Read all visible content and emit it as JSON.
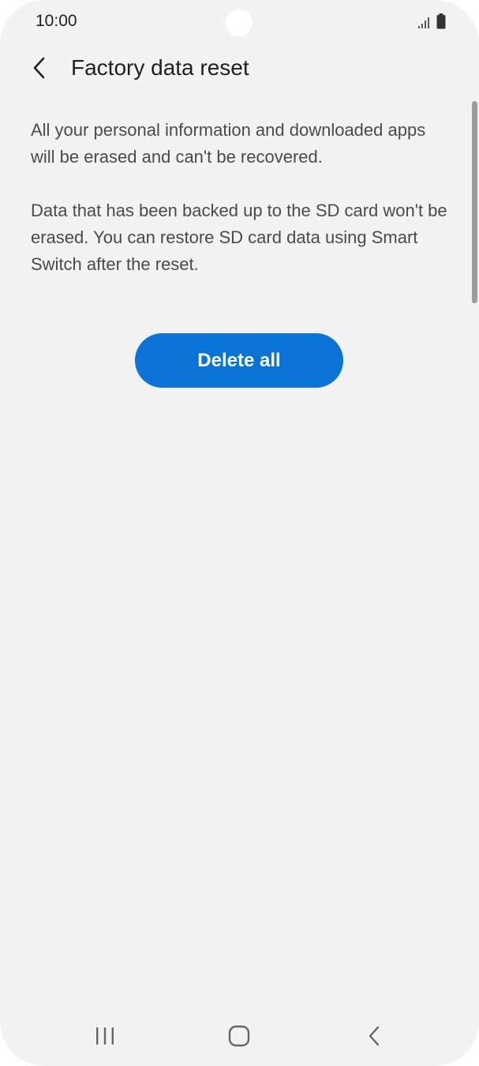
{
  "status_bar": {
    "time": "10:00",
    "icons": [
      "signal-icon",
      "battery-icon"
    ]
  },
  "header": {
    "back_icon": "chevron-left-icon",
    "title": "Factory data reset"
  },
  "content": {
    "paragraph_1": "All your personal information and downloaded apps will be erased and can't be recovered.",
    "paragraph_2": "Data that has been backed up to the SD card won't be erased. You can restore SD card data using Smart Switch after the reset."
  },
  "actions": {
    "delete_all_label": "Delete all"
  },
  "navigation_bar": {
    "buttons": [
      "recents-icon",
      "home-icon",
      "back-icon"
    ]
  },
  "colors": {
    "background": "#f2f2f2",
    "accent": "#0a74d6",
    "title_text": "#202020",
    "body_text": "#4a4a4a"
  }
}
